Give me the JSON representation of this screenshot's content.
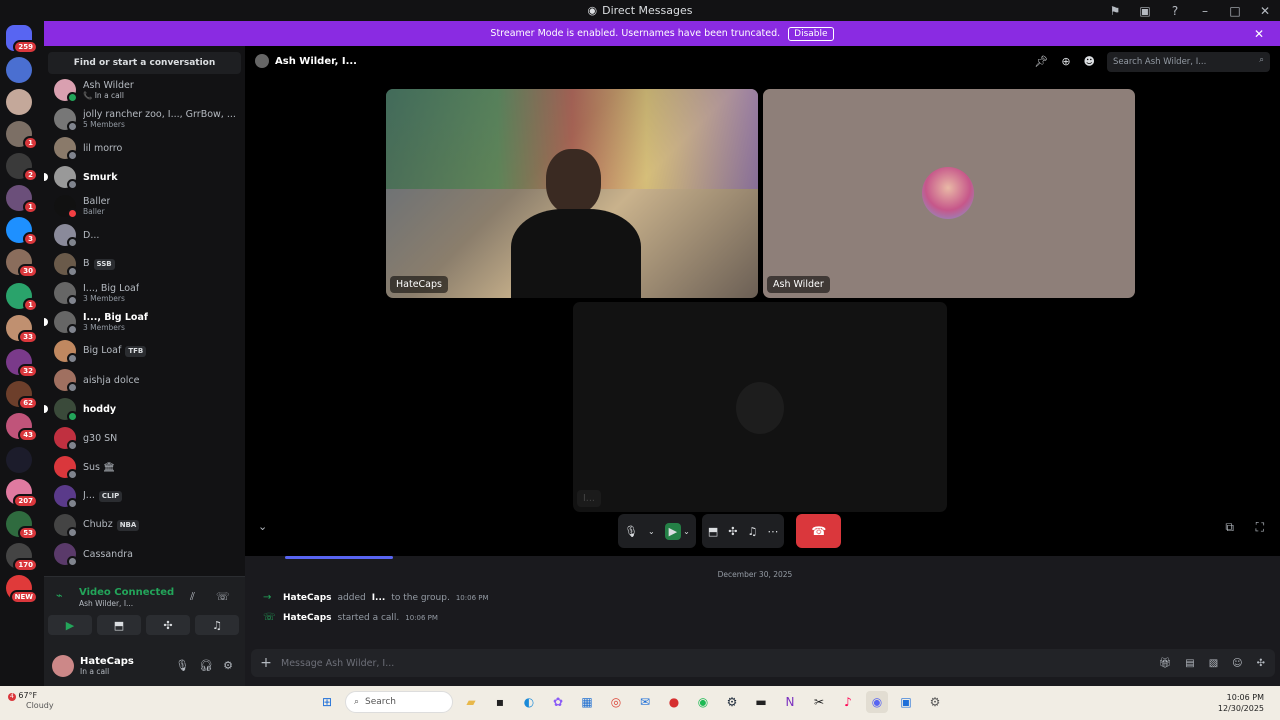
{
  "window": {
    "title": "Direct Messages"
  },
  "servers": {
    "badges": [
      "259",
      "",
      "",
      "1",
      "2",
      "1",
      "3",
      "30",
      "1",
      "33",
      "32",
      "62",
      "43",
      "",
      "207",
      "53",
      "170",
      "NEW"
    ]
  },
  "banner": {
    "text": "Streamer Mode is enabled. Usernames have been truncated.",
    "disable_label": "Disable"
  },
  "dms": {
    "find_label": "Find or start a conversation",
    "items": [
      {
        "name": "Ash Wilder",
        "sub": "📞 In a call",
        "tag": ""
      },
      {
        "name": "jolly rancher zoo, I..., GrrBow, ...",
        "sub": "5 Members",
        "tag": ""
      },
      {
        "name": "lil morro",
        "sub": "",
        "tag": ""
      },
      {
        "name": "Smurk",
        "sub": "",
        "tag": ""
      },
      {
        "name": "Baller",
        "sub": "Baller",
        "tag": ""
      },
      {
        "name": "D...",
        "sub": "",
        "tag": ""
      },
      {
        "name": "B",
        "sub": "",
        "tag": "SSB"
      },
      {
        "name": "I..., Big Loaf",
        "sub": "3 Members",
        "tag": ""
      },
      {
        "name": "I..., Big Loaf",
        "sub": "3 Members",
        "tag": ""
      },
      {
        "name": "Big Loaf",
        "sub": "",
        "tag": "TFB"
      },
      {
        "name": "aishja dolce",
        "sub": "",
        "tag": ""
      },
      {
        "name": "hoddy",
        "sub": "",
        "tag": ""
      },
      {
        "name": "g30 SN",
        "sub": "",
        "tag": ""
      },
      {
        "name": "Sus 🏛",
        "sub": "",
        "tag": ""
      },
      {
        "name": "J...",
        "sub": "",
        "tag": "CLIP"
      },
      {
        "name": "Chubz",
        "sub": "",
        "tag": "NBA"
      },
      {
        "name": "Cassandra",
        "sub": "",
        "tag": ""
      }
    ]
  },
  "voice": {
    "status": "Video Connected",
    "channel": "Ash Wilder, I..."
  },
  "user": {
    "name": "HateCaps",
    "status": "In a call"
  },
  "call": {
    "header_title": "Ash Wilder, I...",
    "search_placeholder": "Search Ash Wilder, I...",
    "tiles": [
      "HateCaps",
      "Ash Wilder",
      "I..."
    ]
  },
  "chat": {
    "date": "December 30, 2025",
    "messages": [
      {
        "author": "HateCaps",
        "pre": "added",
        "target": "I...",
        "post": "to the group.",
        "time": "10:06 PM"
      },
      {
        "author": "HateCaps",
        "pre": "started a call.",
        "target": "",
        "post": "",
        "time": "10:06 PM"
      }
    ],
    "composer_placeholder": "Message Ash Wilder, I..."
  },
  "taskbar": {
    "temp": "67°F",
    "weather": "Cloudy",
    "weather_badge": "4",
    "search_label": "Search",
    "time": "10:06 PM",
    "date": "12/30/2025"
  },
  "colors": {
    "accent": "#8a2be2",
    "green": "#23a55a",
    "red": "#da373c"
  }
}
